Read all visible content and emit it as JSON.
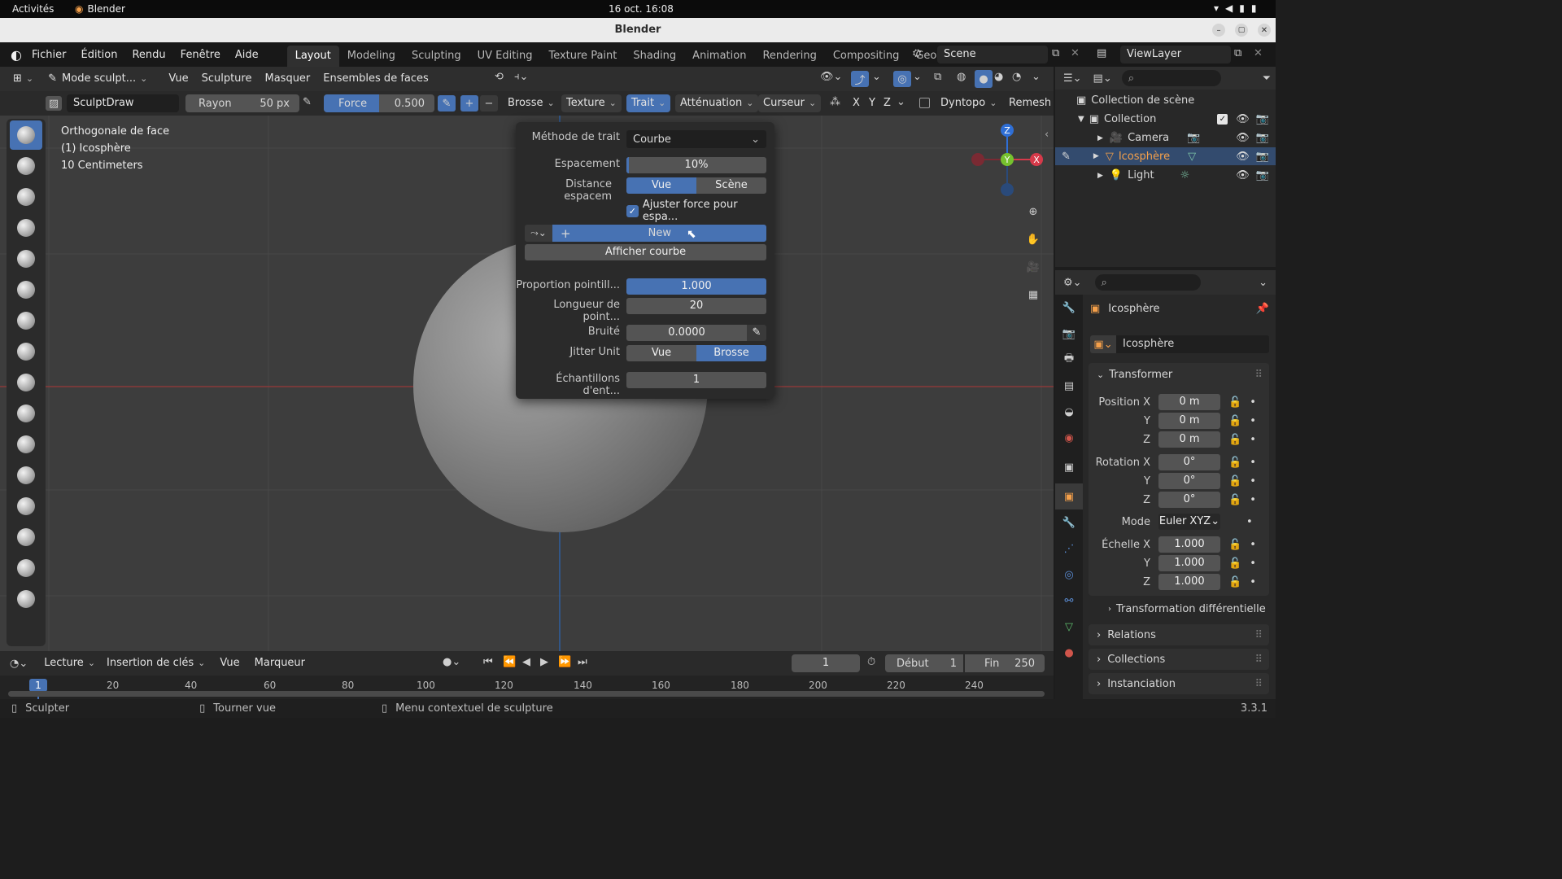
{
  "gnome": {
    "activities": "Activités",
    "app": "Blender",
    "clock": "16 oct. 16:08"
  },
  "window": {
    "title": "Blender"
  },
  "menubar": {
    "items": [
      "Fichier",
      "Édition",
      "Rendu",
      "Fenêtre",
      "Aide"
    ],
    "workspaces": [
      "Layout",
      "Modeling",
      "Sculpting",
      "UV Editing",
      "Texture Paint",
      "Shading",
      "Animation",
      "Rendering",
      "Compositing",
      "Geome"
    ],
    "scene": "Scene",
    "view_layer": "ViewLayer"
  },
  "viewport_header": {
    "mode": "Mode sculpt...",
    "menus": [
      "Vue",
      "Sculpture",
      "Masquer",
      "Ensembles de faces"
    ]
  },
  "tool_header": {
    "brush_name": "SculptDraw",
    "radius_label": "Rayon",
    "radius_value": "50 px",
    "strength_label": "Force",
    "strength_value": "0.500",
    "menus": [
      "Brosse",
      "Texture",
      "Trait",
      "Atténuation",
      "Curseur"
    ],
    "axes": [
      "X",
      "Y",
      "Z"
    ],
    "dyntopo": "Dyntopo",
    "remesh": "Remesh"
  },
  "viewport_info": {
    "line1": "Orthogonale de face",
    "line2": "(1) Icosphère",
    "line3": "10 Centimeters"
  },
  "gizmo": {
    "z": "Z",
    "y": "Y",
    "x": "X"
  },
  "stroke_panel": {
    "method_label": "Méthode de trait",
    "method_value": "Courbe",
    "spacing_label": "Espacement",
    "spacing_value": "10%",
    "spacing_fill": 0.1,
    "distance_label": "Distance espacem",
    "distance_opt1": "Vue",
    "distance_opt2": "Scène",
    "adjust_label": "Ajuster force pour espa...",
    "new_label": "New",
    "show_curve": "Afficher courbe",
    "dash_ratio_label": "Proportion pointill...",
    "dash_ratio_value": "1.000",
    "dash_length_label": "Longueur de point...",
    "dash_length_value": "20",
    "jitter_label": "Bruité",
    "jitter_value": "0.0000",
    "jitter_unit_label": "Jitter Unit",
    "jitter_opt1": "Vue",
    "jitter_opt2": "Brosse",
    "samples_label": "Échantillons d'ent...",
    "samples_value": "1"
  },
  "outliner": {
    "root": "Collection de scène",
    "collection": "Collection",
    "items": [
      "Camera",
      "Icosphère",
      "Light"
    ]
  },
  "properties": {
    "object_name": "Icosphère",
    "data_name": "Icosphère",
    "transform_title": "Transformer",
    "position_label": "Position X",
    "rotation_label": "Rotation X",
    "scale_label": "Échelle X",
    "axis_y": "Y",
    "axis_z": "Z",
    "position": [
      "0 m",
      "0 m",
      "0 m"
    ],
    "rotation": [
      "0°",
      "0°",
      "0°"
    ],
    "scale": [
      "1.000",
      "1.000",
      "1.000"
    ],
    "mode_label": "Mode",
    "mode_value": "Euler XYZ",
    "delta_transform": "Transformation différentielle",
    "relations": "Relations",
    "collections": "Collections",
    "instancing": "Instanciation"
  },
  "timeline": {
    "menus": [
      "Lecture",
      "Insertion de clés",
      "Vue",
      "Marqueur"
    ],
    "current_frame": "1",
    "start_label": "Début",
    "start_value": "1",
    "end_label": "Fin",
    "end_value": "250",
    "ticks": [
      "1",
      "20",
      "40",
      "60",
      "80",
      "100",
      "120",
      "140",
      "160",
      "180",
      "200",
      "220",
      "240"
    ]
  },
  "status": {
    "sculpt": "Sculpter",
    "rotate": "Tourner vue",
    "context": "Menu contextuel de sculpture",
    "version": "3.3.1"
  },
  "colors": {
    "accent": "#4772b3",
    "selected_object": "#f5a04a"
  }
}
